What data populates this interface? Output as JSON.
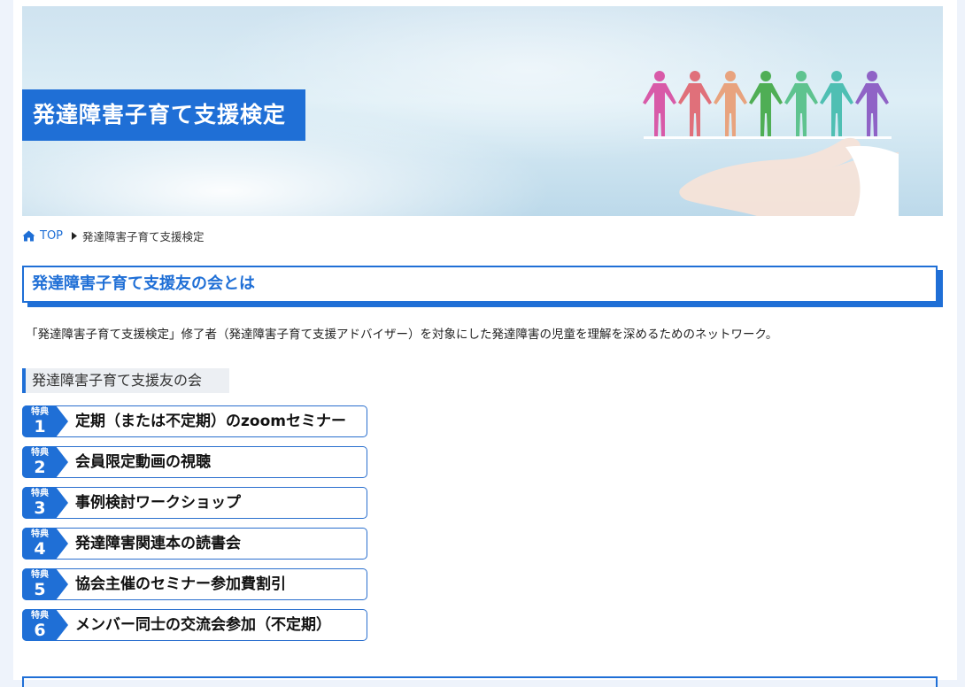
{
  "banner": {
    "title": "発達障害子育て支援検定"
  },
  "breadcrumb": {
    "home": "TOP",
    "current": "発達障害子育て支援検定"
  },
  "section": {
    "title": "発達障害子育て支援友の会とは",
    "intro": "「発達障害子育て支援検定」修了者（発達障害子育て支援アドバイザー）を対象にした発達障害の児童を理解を深めるためのネットワーク。"
  },
  "subsection": {
    "title": "発達障害子育て支援友の会"
  },
  "benefits": [
    {
      "label": "特典",
      "num": "1",
      "text": "定期（または不定期）のzoomセミナー"
    },
    {
      "label": "特典",
      "num": "2",
      "text": "会員限定動画の視聴"
    },
    {
      "label": "特典",
      "num": "3",
      "text": "事例検討ワークショップ"
    },
    {
      "label": "特典",
      "num": "4",
      "text": "発達障害関連本の読書会"
    },
    {
      "label": "特典",
      "num": "5",
      "text": "協会主催のセミナー参加費割引"
    },
    {
      "label": "特典",
      "num": "6",
      "text": "メンバー同士の交流会参加（不定期）"
    }
  ],
  "colors": {
    "accent": "#1f6fd6"
  }
}
